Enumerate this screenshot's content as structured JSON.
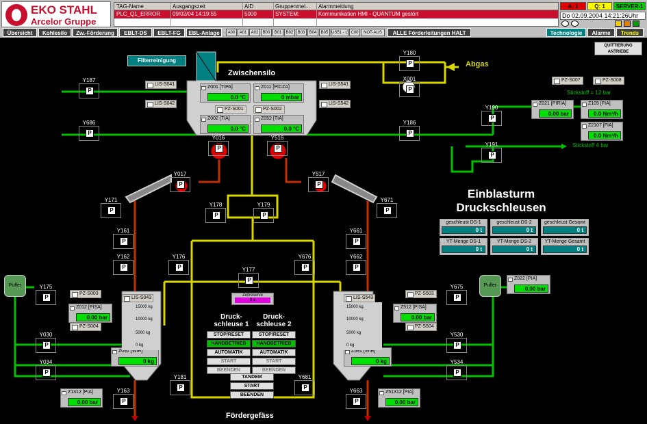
{
  "logo": {
    "line1": "EKO STAHL",
    "line2": "Arcelor Gruppe"
  },
  "alarm_table": {
    "headers": [
      "TAG-Name",
      "Ausgangszeit",
      "AID",
      "Gruppenmel...",
      "Alarmmeldung"
    ],
    "row": [
      "PLC_Q1_ERROR",
      "09/02/04 14:19:55",
      "5000",
      "SYSTEM:",
      "Kommunikation HMI - QUANTUM gestört"
    ]
  },
  "status": {
    "a": "A: 1",
    "q": "Q: 1",
    "server": "SERVER-1",
    "datetime": "Do  02.09.2004 14:21:26Uhr"
  },
  "nav": {
    "buttons": [
      "Übersicht",
      "Kohlesilo",
      "Zw.-Förderung",
      "EBLT-DS",
      "EBLT-FG",
      "EBL-Anlage"
    ],
    "small": [
      "A00",
      "A01",
      "A02",
      "B00",
      "B01",
      "B02",
      "B03",
      "B04",
      "B05",
      "US51 - LV",
      "C00",
      "NOT-AUS"
    ],
    "halt": "ALLE Förderleitungen HALT",
    "tabs": [
      "Technologie",
      "Alarme",
      "Trends"
    ],
    "quittierung": "QUITTIERUNG ANTRIEBE"
  },
  "process": {
    "filter": "Filterreinigung",
    "zwischensilo": "Zwischensilo",
    "abgas": "Abgas",
    "stickstoff12": "Stickstoff = 12 bar",
    "stickstoff4": "Stickstoff 4 bar",
    "puffer": "Puffer",
    "foerdergefaess": "Fördergefäss",
    "title1": "Einblasturm",
    "title2": "Druckschleusen",
    "ds1_title": "Druck-\nschleuse 1",
    "ds2_title": "Druck-\nschleuse 2",
    "ds1_title_l1": "Druck-",
    "ds1_title_l2": "schleuse 1",
    "ds2_title_l1": "Druck-",
    "ds2_title_l2": "schleuse 2",
    "zeitreserve": "Zeitreserve",
    "zeitreserve_val": "0 s",
    "ctl_left": [
      "STOP/RESET",
      "HANDBETRIEB",
      "AUTOMATIK",
      "START",
      "BEENDEN"
    ],
    "ctl_right": [
      "STOP/RESET",
      "HANDBETRIEB",
      "AUTOMATIK",
      "START",
      "BEENDEN"
    ],
    "ctl_mid": [
      "TANDEM",
      "START",
      "BEENDEN"
    ],
    "valves": [
      "Y187",
      "Y686",
      "Y180",
      "X001",
      "Y190",
      "Y191",
      "Y186",
      "Y016",
      "Y516",
      "Y017",
      "Y517",
      "Y171",
      "Y671",
      "Y178",
      "Y179",
      "Y161",
      "Y661",
      "Y162",
      "Y176",
      "Y676",
      "Y662",
      "Y177",
      "Y175",
      "Y675",
      "Y030",
      "Y034",
      "Y530",
      "Y534",
      "Y181",
      "Y681",
      "Y163",
      "Y663"
    ],
    "tags": [
      "LIS-S041",
      "LIS-S042",
      "LIS-S541",
      "LIS-S542",
      "PZ-S001",
      "PZ-S002",
      "PZ-S007",
      "PZ-S008",
      "PZ-S003",
      "PZ-S004",
      "LIS-S043",
      "PZ-S503",
      "PZ-S504",
      "LIS-S543"
    ],
    "instruments": [
      {
        "t": "Z001 [TIPA]",
        "v": "0.0 °C"
      },
      {
        "t": "Z011 [PICZA]",
        "v": "0 mbar"
      },
      {
        "t": "Z002 [TIA]",
        "v": "0.0 °C"
      },
      {
        "t": "Z052 [TIA]",
        "v": "0.0 °C"
      },
      {
        "t": "Z021 [PIRIA]",
        "v": "0.00 bar"
      },
      {
        "t": "Z105 [FIA]",
        "v": "0.0 Nm³/h"
      },
      {
        "t": "Z2107 [FIA]",
        "v": "0.0 Nm³/h"
      },
      {
        "t": "Z012 [PISA]",
        "v": "0.00 bar"
      },
      {
        "t": "Z091 [WIR]",
        "v": "0 kg"
      },
      {
        "t": "Z1312 [PIA]",
        "v": "0.00 bar"
      },
      {
        "t": "Z022 [PIA]",
        "v": "0.00 bar"
      },
      {
        "t": "Z512 [PISA]",
        "v": "0.00 bar"
      },
      {
        "t": "Z591 [WIR]",
        "v": "0 kg"
      },
      {
        "t": "Z51312 [PIA]",
        "v": "0.00 bar"
      }
    ],
    "scale": [
      "15000 kg",
      "10000 kg",
      "5000 kg",
      "0 kg"
    ],
    "stats": [
      {
        "t": "geschleust DS-1",
        "v": "0 t"
      },
      {
        "t": "geschleust DS-2",
        "v": "0 t"
      },
      {
        "t": "geschleust Gesamt",
        "v": "0 t"
      },
      {
        "t": "YT-Menge DS-1",
        "v": "0 t"
      },
      {
        "t": "YT-Menge DS-2",
        "v": "0 t"
      },
      {
        "t": "YT-Menge Gesamt",
        "v": "0 t"
      }
    ]
  },
  "colors": {
    "green": "#00c000",
    "yellow": "#d8d800",
    "red": "#c83000",
    "teal": "#008080",
    "magenta": "#e000e0"
  }
}
